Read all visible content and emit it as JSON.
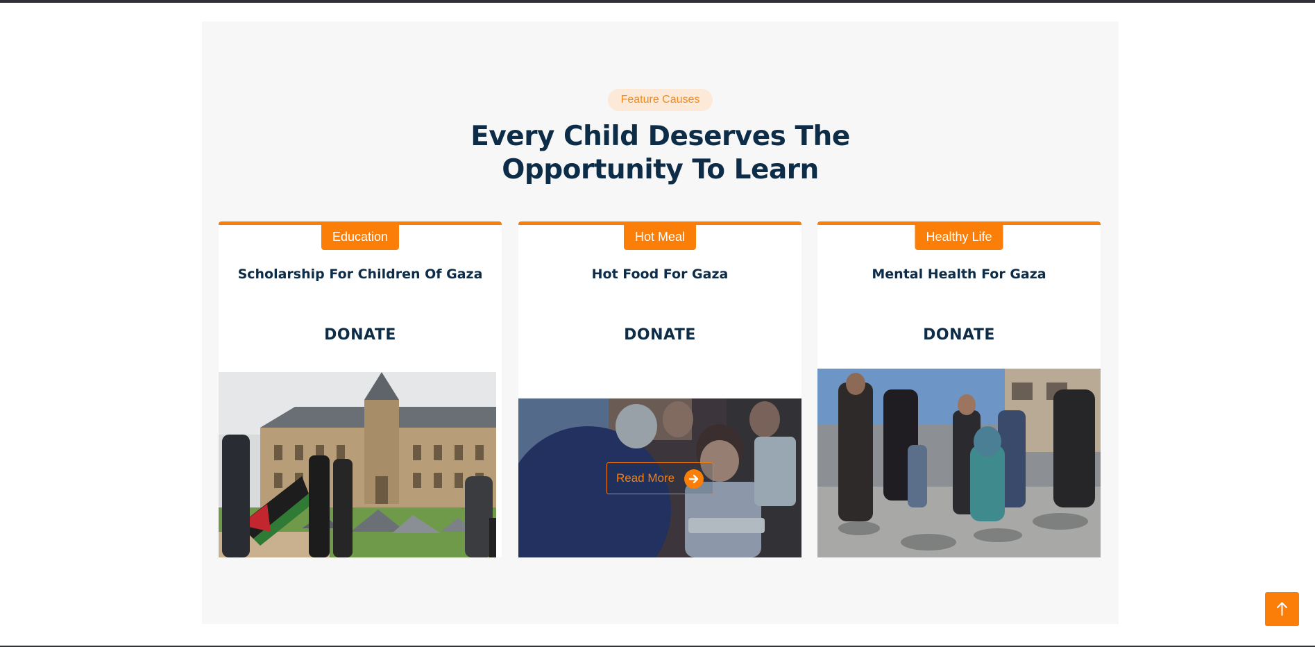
{
  "section": {
    "badge": "Feature Causes",
    "heading_line1": "Every Child Deserves The",
    "heading_line2": "Opportunity To Learn"
  },
  "causes": [
    {
      "tag": "Education",
      "title": "Scholarship For Children Of Gaza",
      "donate_label": "DONATE"
    },
    {
      "tag": "Hot Meal",
      "title": "Hot Food For Gaza",
      "donate_label": "DONATE",
      "read_more_label": "Read More"
    },
    {
      "tag": "Healthy Life",
      "title": "Mental Health For Gaza",
      "donate_label": "DONATE"
    }
  ],
  "icons": {
    "read_more": "arrow-right-icon",
    "scroll_top": "arrow-up-icon"
  },
  "colors": {
    "accent": "#fa7e08",
    "heading": "#0c2c47",
    "badge_bg": "#fde9d7",
    "section_bg": "#f7f7f7"
  }
}
